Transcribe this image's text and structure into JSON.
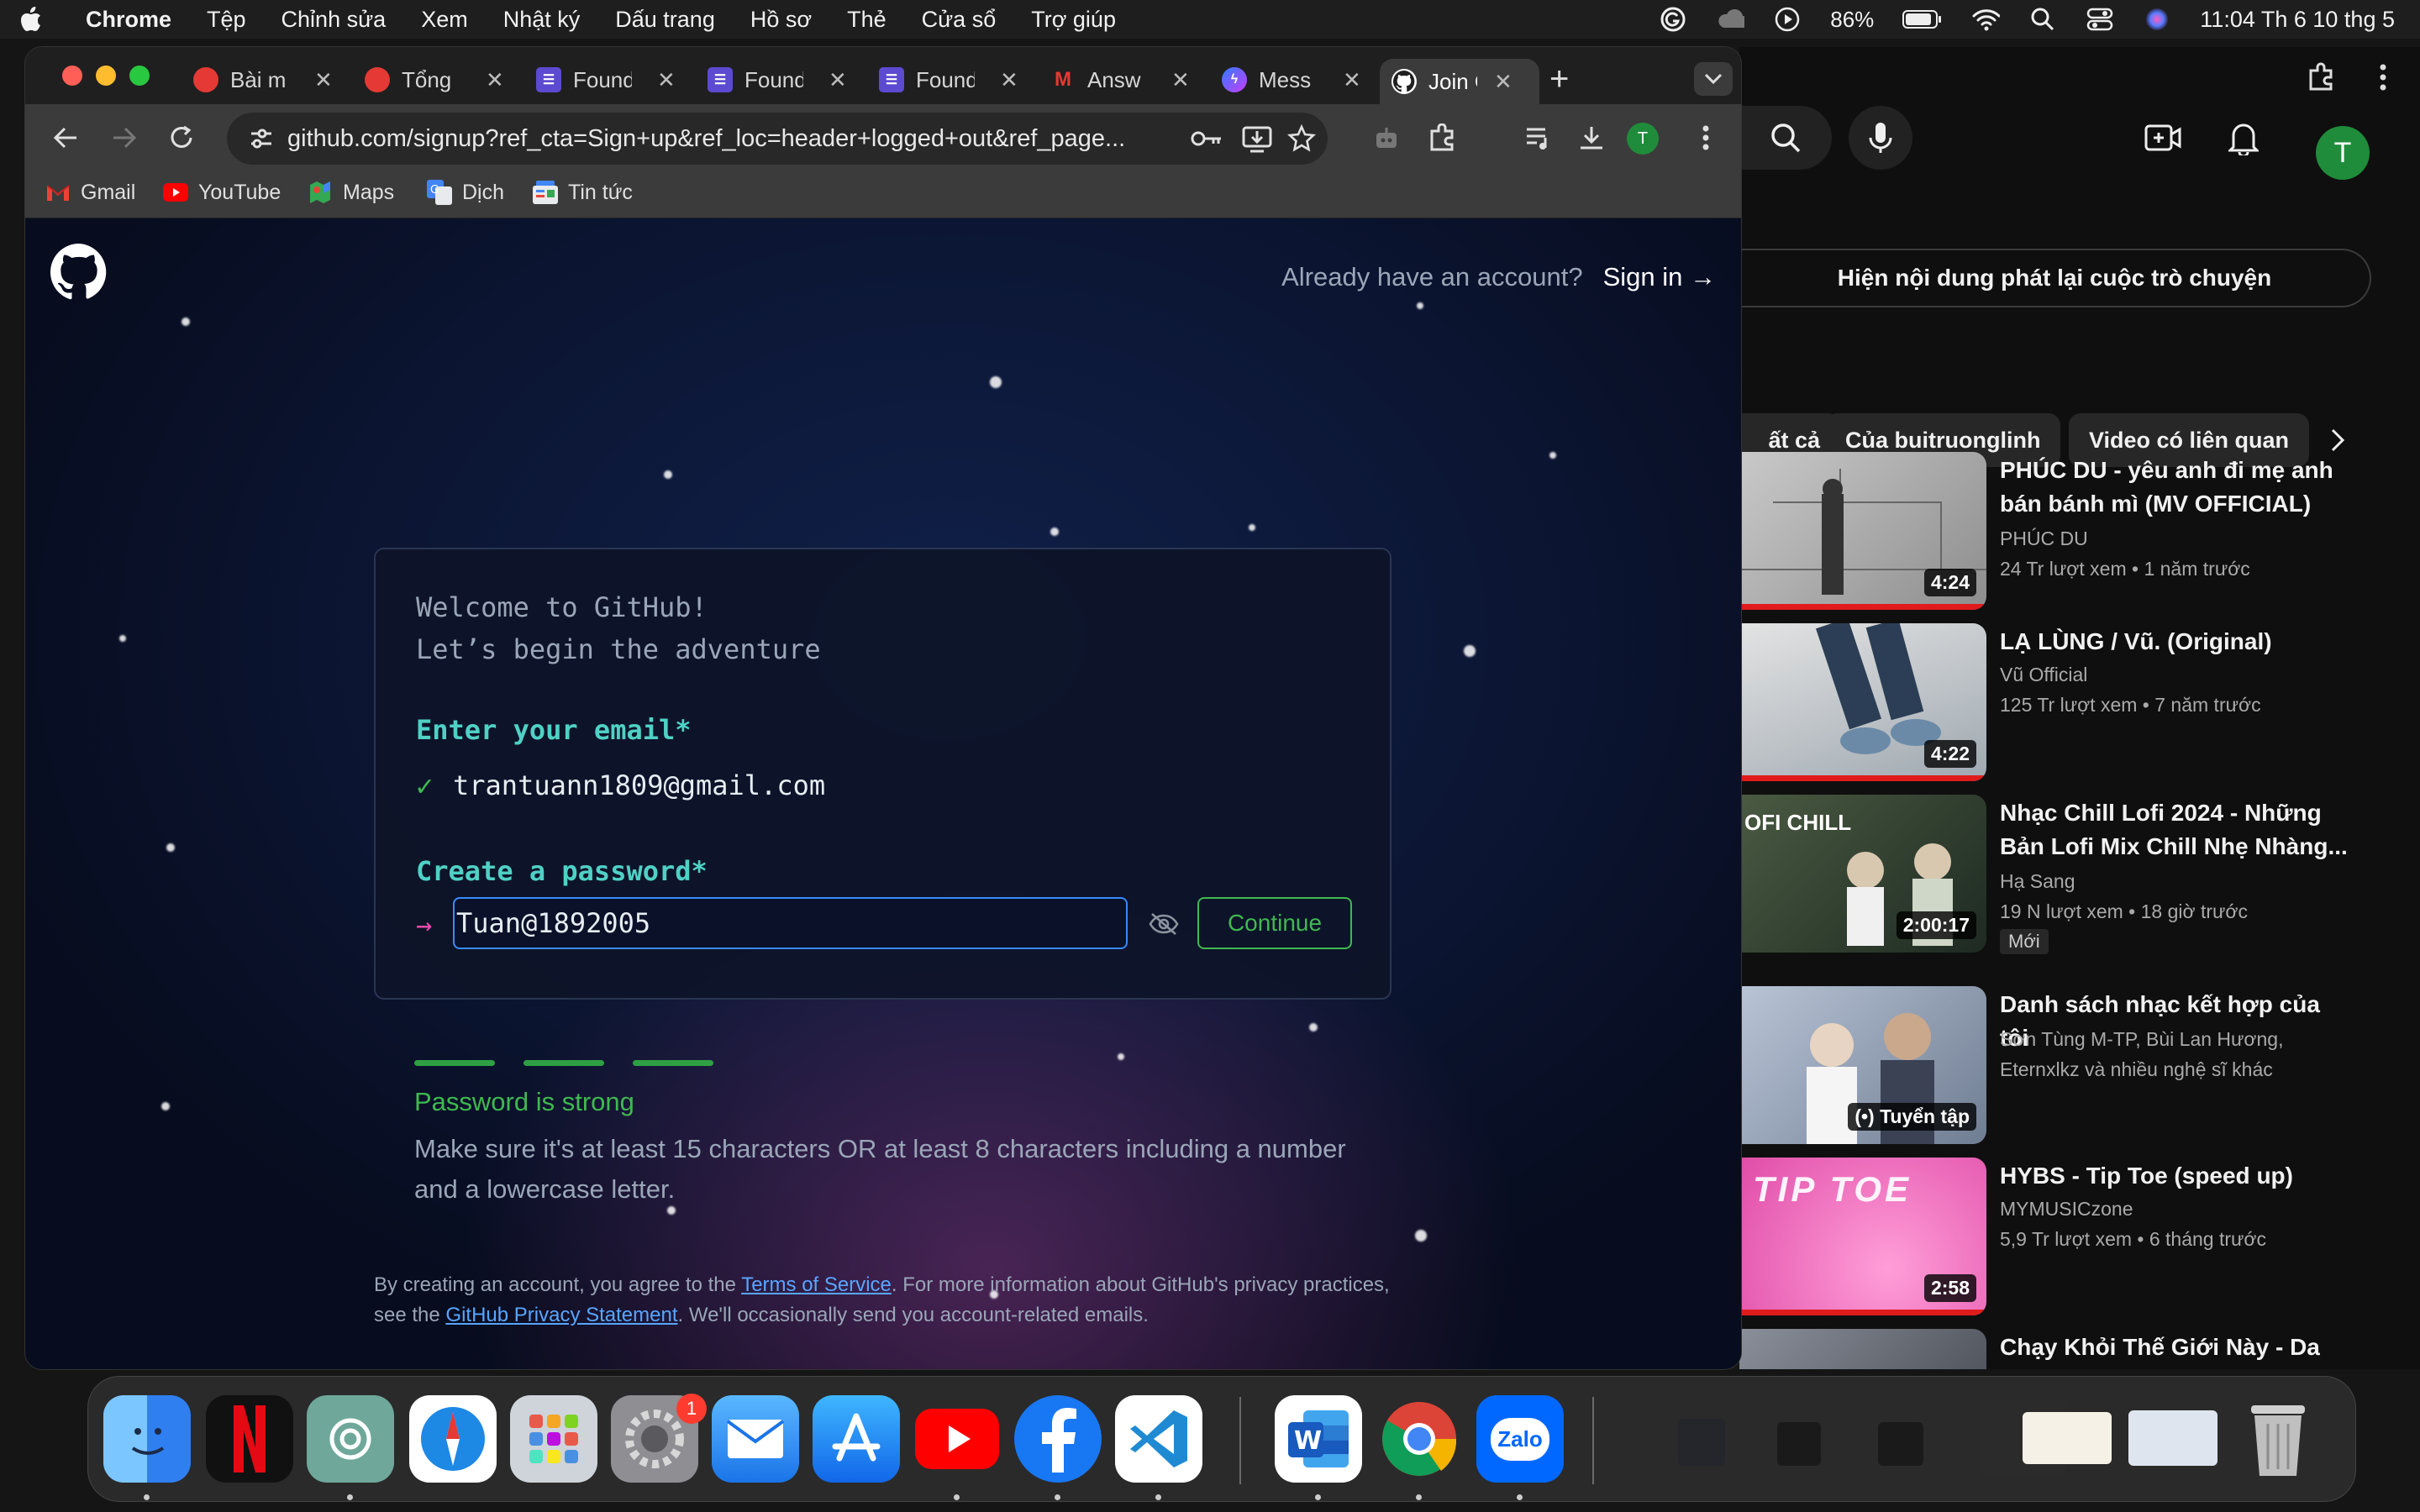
{
  "menubar": {
    "items": [
      "Chrome",
      "Tệp",
      "Chỉnh sửa",
      "Xem",
      "Nhật ký",
      "Dấu trang",
      "Hồ sơ",
      "Thẻ",
      "Cửa sổ",
      "Trợ giúp"
    ],
    "battery": "86%",
    "clock": "11:04 Th 6 10 thg 5"
  },
  "tabs": [
    {
      "label": "Bài m",
      "icon": "red-circle-icon"
    },
    {
      "label": "Tổng",
      "icon": "red-circle-icon"
    },
    {
      "label": "Found",
      "icon": "purple-list-icon"
    },
    {
      "label": "Found",
      "icon": "purple-list-icon"
    },
    {
      "label": "Found",
      "icon": "purple-list-icon"
    },
    {
      "label": "Answ",
      "icon": "red-m-icon"
    },
    {
      "label": "Mess",
      "icon": "messenger-icon"
    },
    {
      "label": "Join G",
      "icon": "github-icon",
      "active": true
    }
  ],
  "omnibox": {
    "url": "github.com/signup?ref_cta=Sign+up&ref_loc=header+logged+out&ref_page..."
  },
  "profile": {
    "initial": "T"
  },
  "bookmarks": [
    "Gmail",
    "YouTube",
    "Maps",
    "Dịch",
    "Tin tức"
  ],
  "github": {
    "signin_question": "Already have an account?",
    "signin_link": "Sign in →",
    "welcome_line1": "Welcome to GitHub!",
    "welcome_line2": "Let’s begin the adventure",
    "email_label": "Enter your email*",
    "email_value": "trantuann1809@gmail.com",
    "password_label": "Create a password*",
    "password_value": "Tuan@1892005",
    "continue_label": "Continue",
    "strength_text": "Password is strong",
    "strength_level": "3/3",
    "strength_hint": "Make sure it's at least 15 characters OR at least 8 characters including a number and a lowercase letter.",
    "terms_prefix": "By creating an account, you agree to the ",
    "terms_link": "Terms of Service",
    "terms_middle": ". For more information about GitHub's privacy practices, see the ",
    "privacy_link": "GitHub Privacy Statement",
    "terms_suffix": ". We'll occasionally send you account-related emails."
  },
  "youtube": {
    "avatar_initial": "T",
    "replay_label": "Hiện nội dung phát lại cuộc trò chuyện",
    "chips": [
      "ất cả",
      "Của buitruonglinh",
      "Video có liên quan"
    ],
    "videos": [
      {
        "title": "PHÚC DU - yêu anh đi mẹ anh bán bánh mì (MV OFFICIAL)",
        "channel": "PHÚC DU",
        "meta": "24 Tr lượt xem  • 1 năm trước",
        "duration": "4:24"
      },
      {
        "title": "LẠ LÙNG / Vũ. (Original)",
        "channel": "Vũ Official",
        "meta": "125 Tr lượt xem  • 7 năm trước",
        "duration": "4:22"
      },
      {
        "title": "Nhạc Chill Lofi 2024 - Những Bản Lofi Mix Chill Nhẹ Nhàng...",
        "channel": "Hạ Sang",
        "meta": "19 N lượt xem  • 18 giờ trước",
        "duration": "2:00:17",
        "badge": "Mới",
        "thumb_text": "OFI CHILL"
      },
      {
        "title": "Danh sách nhạc kết hợp của tôi",
        "channel": "Sơn Tùng M-TP, Bùi Lan Hương,",
        "channel2": "Eternxlkz và nhiều nghệ sĩ khác",
        "duration": "(•) Tuyển tập"
      },
      {
        "title": "HYBS - Tip Toe (speed up)",
        "channel": "MYMUSICzone",
        "meta": "5,9 Tr lượt xem  • 6 tháng trước",
        "duration": "2:58",
        "thumb_text": "TIP TOE"
      },
      {
        "title": "Chạy Khỏi Thế Giới Này - Da LAB ft. Phương Ly (Official..."
      }
    ]
  },
  "dock": {
    "apps": [
      "finder",
      "netflix",
      "chatgpt",
      "safari",
      "launchpad",
      "system-settings",
      "mail",
      "app-store",
      "youtube",
      "facebook",
      "vscode",
      "word",
      "chrome",
      "zalo"
    ],
    "settings_badge": "1",
    "zalo_label": "Zalo"
  }
}
